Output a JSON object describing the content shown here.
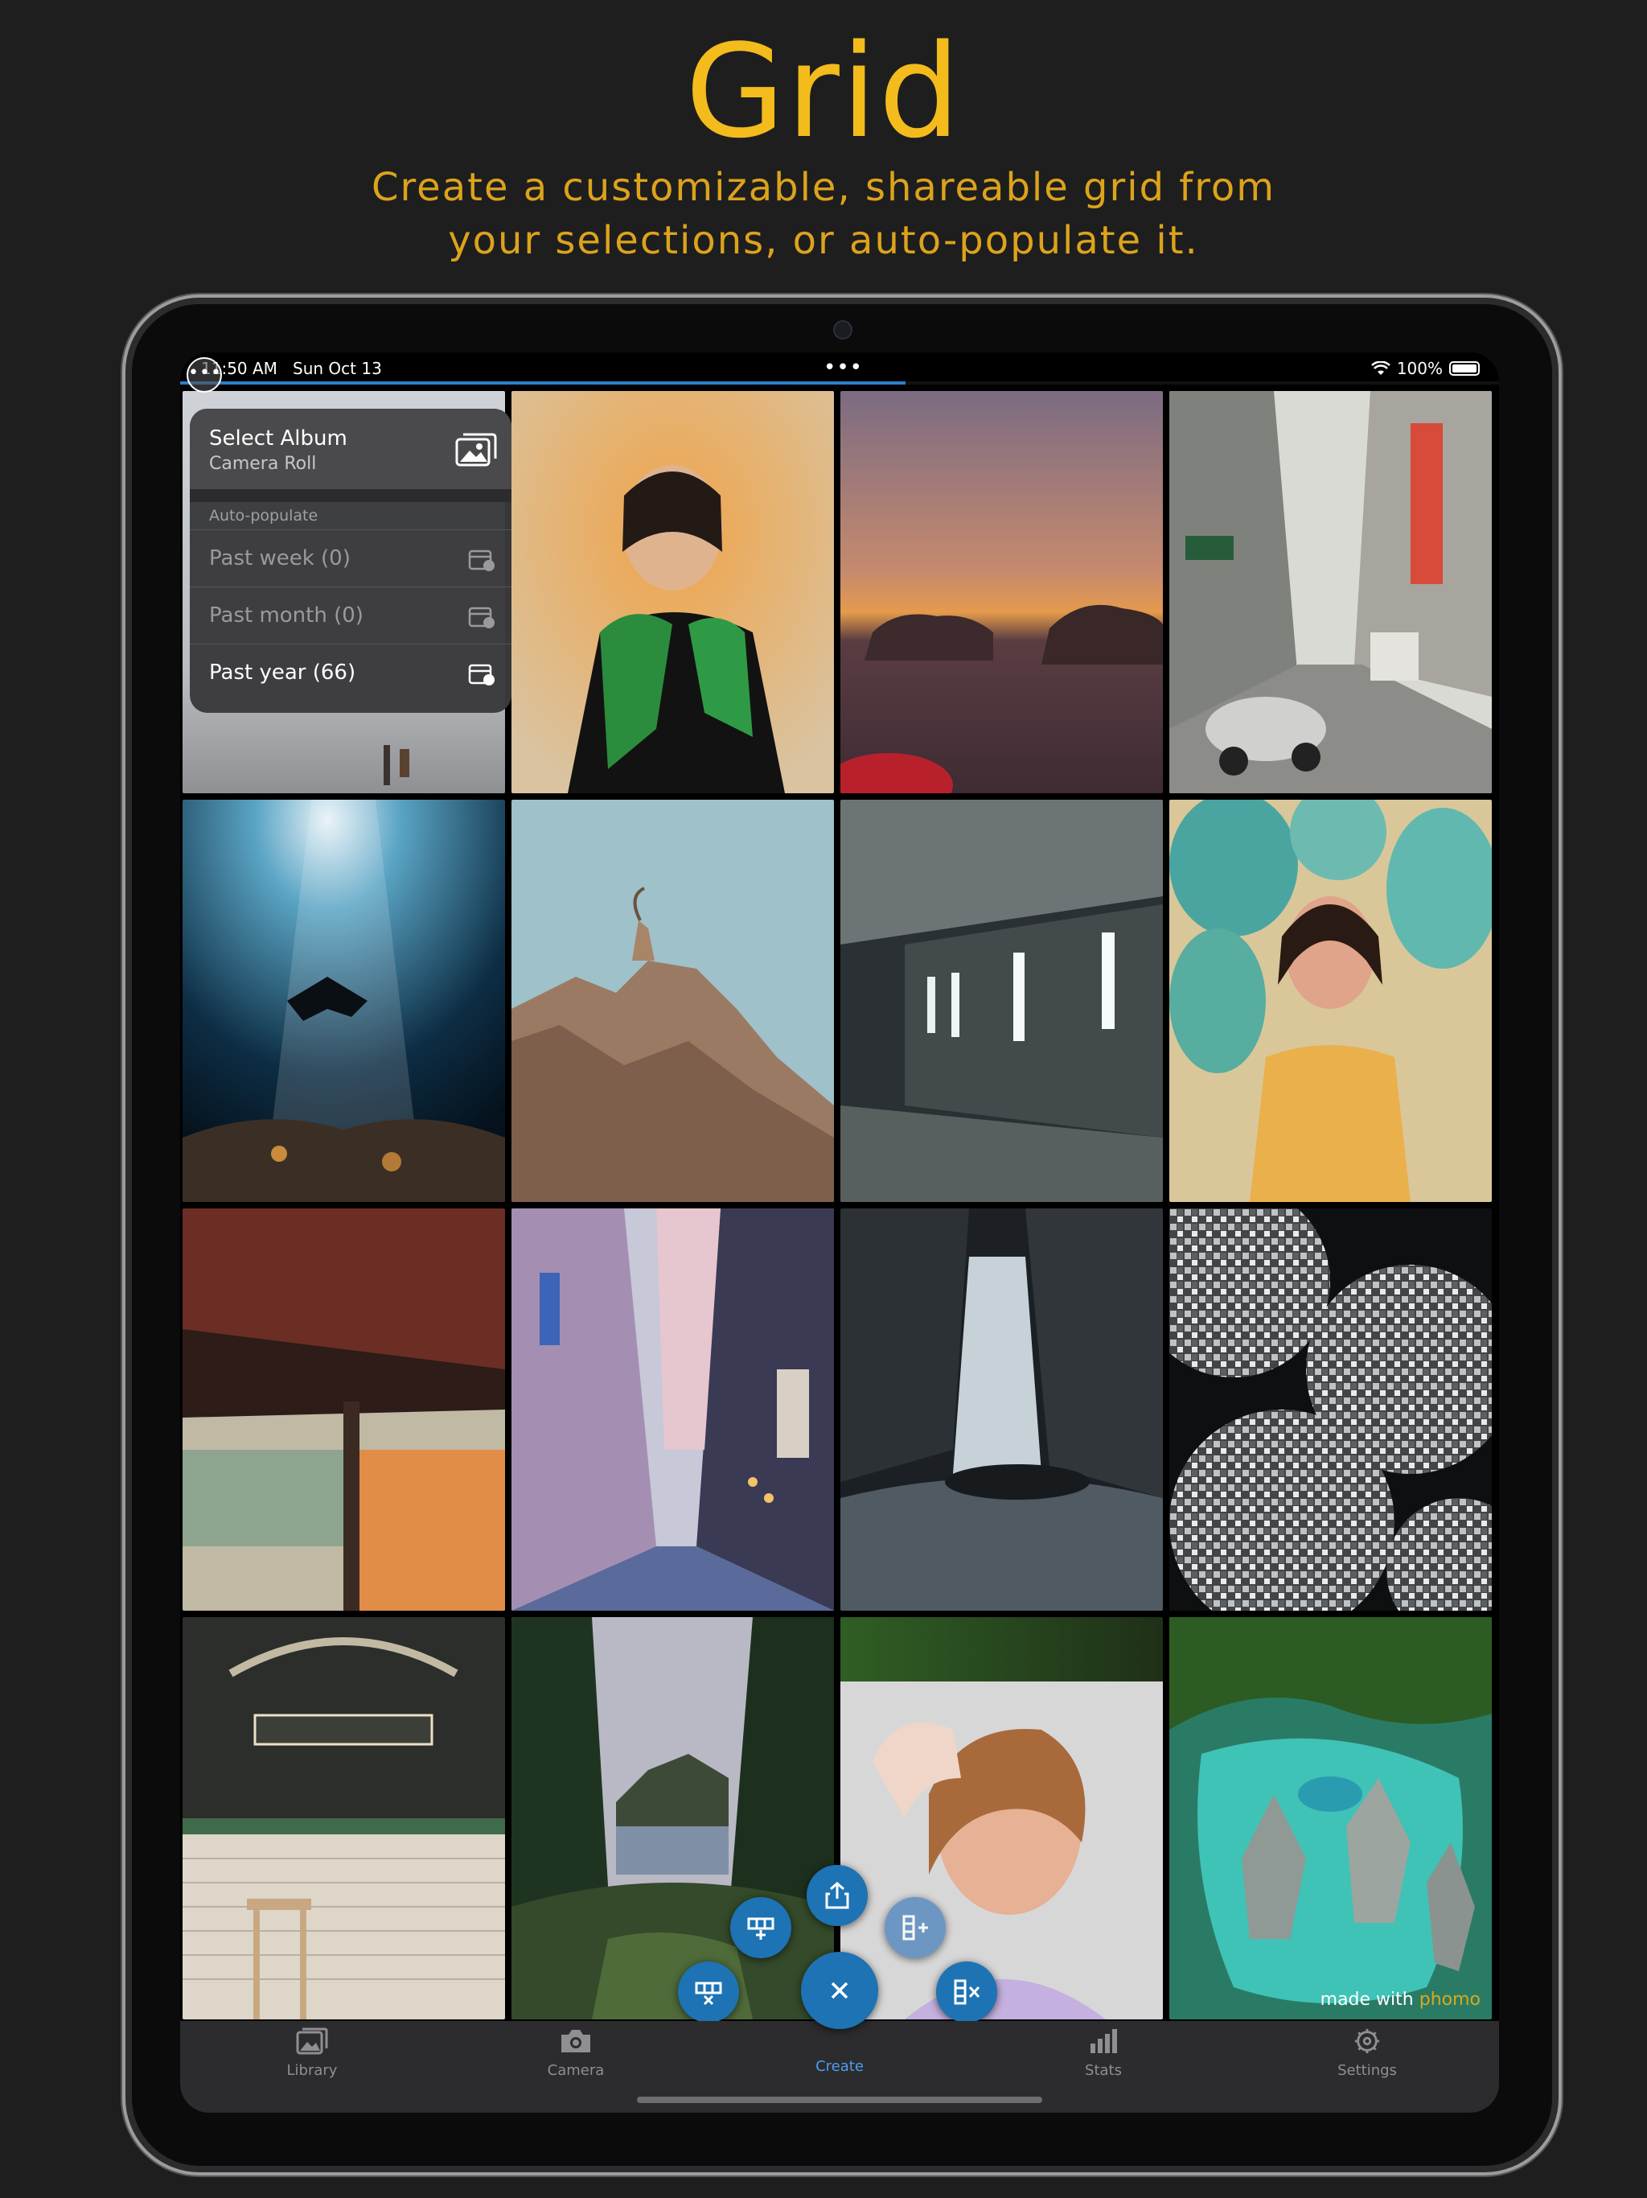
{
  "headline": "Grid",
  "subheadline_line1": "Create a customizable, shareable grid from",
  "subheadline_line2": "your selections, or auto-populate it.",
  "status_bar": {
    "time": "11:50 AM",
    "date": "Sun Oct 13",
    "battery": "100%",
    "more_dots": "•••"
  },
  "menu": {
    "album_title": "Select Album",
    "album_name": "Camera Roll",
    "section_label": "Auto-populate",
    "options": [
      {
        "label": "Past week (0)",
        "enabled": false
      },
      {
        "label": "Past month (0)",
        "enabled": false
      },
      {
        "label": "Past year (66)",
        "enabled": true
      }
    ]
  },
  "watermark": {
    "prefix": "made with",
    "brand": "phomo"
  },
  "tabs": [
    {
      "label": "Library",
      "icon": "photo-library-icon",
      "active": false
    },
    {
      "label": "Camera",
      "icon": "camera-icon",
      "active": false
    },
    {
      "label": "Create",
      "icon": "close-icon",
      "active": true
    },
    {
      "label": "Stats",
      "icon": "bar-chart-icon",
      "active": false
    },
    {
      "label": "Settings",
      "icon": "gear-icon",
      "active": false
    }
  ],
  "colors": {
    "accent": "#f3bc1c",
    "tab_active": "#4d9cf0",
    "fab": "#1d73b3",
    "background": "#1e1e1f"
  },
  "grid_photos": [
    "menu-backdrop",
    "woman-green-scarf",
    "desert-sunset",
    "street-scooter",
    "underwater-diver",
    "ibex-on-rock",
    "parking-garage",
    "woman-balloons",
    "industrial-roof",
    "city-alley",
    "waterfall",
    "disco-balls",
    "burger-shop",
    "forest-coast",
    "woman-hair",
    "lagoon-aerial"
  ],
  "progress": 0.55
}
